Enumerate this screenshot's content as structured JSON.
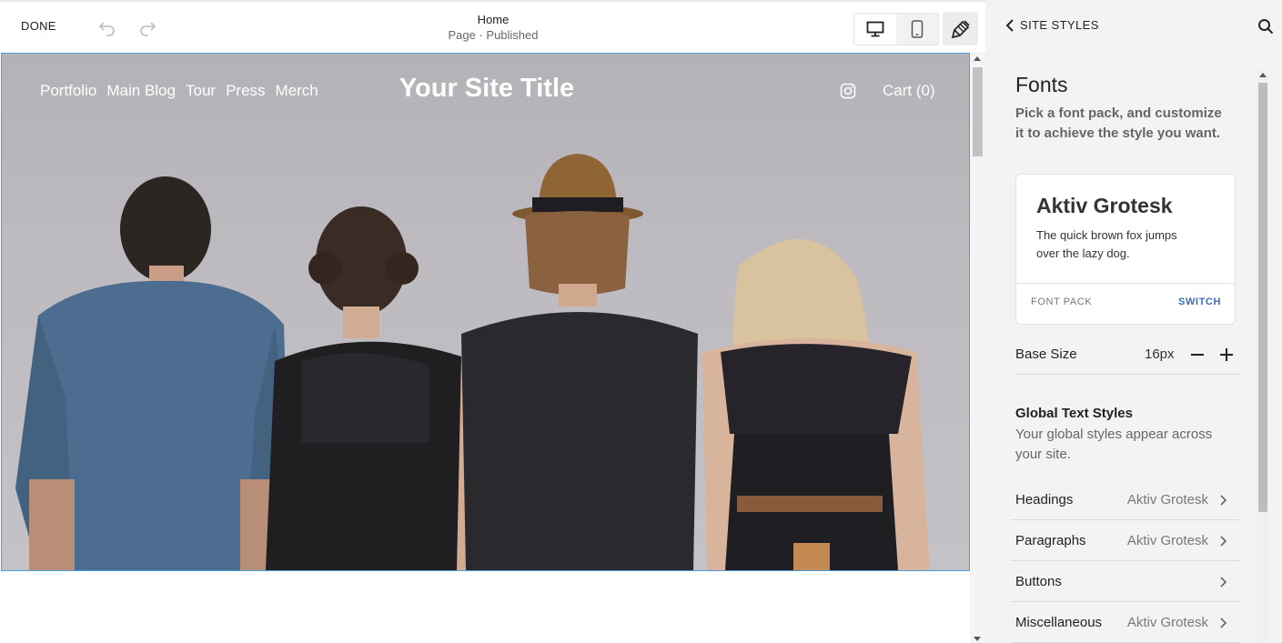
{
  "toolbar": {
    "done_label": "DONE",
    "page_title": "Home",
    "page_status": "Page · Published"
  },
  "site": {
    "nav": [
      "Portfolio",
      "Main Blog",
      "Tour",
      "Press",
      "Merch"
    ],
    "title": "Your Site Title",
    "cart": "Cart (0)"
  },
  "panel": {
    "back_label": "SITE STYLES",
    "fonts_heading": "Fonts",
    "fonts_description": "Pick a font pack, and customize it to achieve the style you want.",
    "font_card": {
      "name": "Aktiv Grotesk",
      "sample": "The quick brown fox jumps over the lazy dog.",
      "pack_label": "FONT PACK",
      "switch_label": "SWITCH"
    },
    "base_size": {
      "label": "Base Size",
      "value": "16px"
    },
    "global_heading": "Global Text Styles",
    "global_description": "Your global styles appear across your site.",
    "style_rows": [
      {
        "label": "Headings",
        "value": "Aktiv Grotesk"
      },
      {
        "label": "Paragraphs",
        "value": "Aktiv Grotesk"
      },
      {
        "label": "Buttons",
        "value": ""
      },
      {
        "label": "Miscellaneous",
        "value": "Aktiv Grotesk"
      }
    ]
  },
  "colors": {
    "accent": "#3c6fb9",
    "selection_border": "#4a9fe0",
    "panel_bg": "#f3f3f3"
  }
}
